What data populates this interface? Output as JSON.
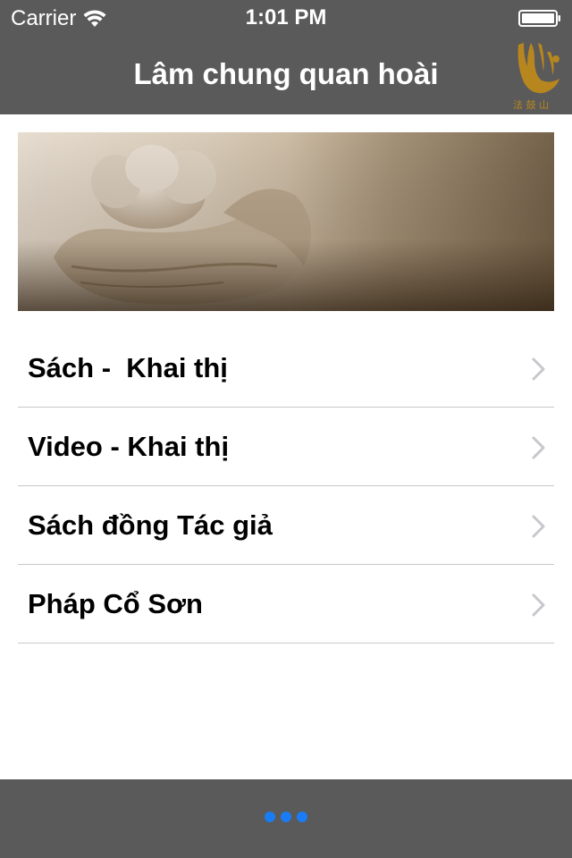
{
  "status_bar": {
    "carrier": "Carrier",
    "time": "1:01 PM"
  },
  "nav": {
    "title": "Lâm chung quan hoài",
    "logo_icon": "dharma-drum-logo-icon"
  },
  "banner": {
    "image": "hands-holding-lotus-photo"
  },
  "menu": {
    "items": [
      {
        "label": "Sách -  Khai thị"
      },
      {
        "label": "Video - Khai thị"
      },
      {
        "label": "Sách đồng Tác giả"
      },
      {
        "label": "Pháp Cổ Sơn"
      }
    ]
  },
  "bottom_bar": {
    "dots": 3,
    "dot_color": "#1a7cf5"
  },
  "colors": {
    "bar_background": "#5a5a5a",
    "logo_gold": "#b8861f",
    "separator": "#c8c8cc",
    "chevron": "#c7c7cc"
  }
}
